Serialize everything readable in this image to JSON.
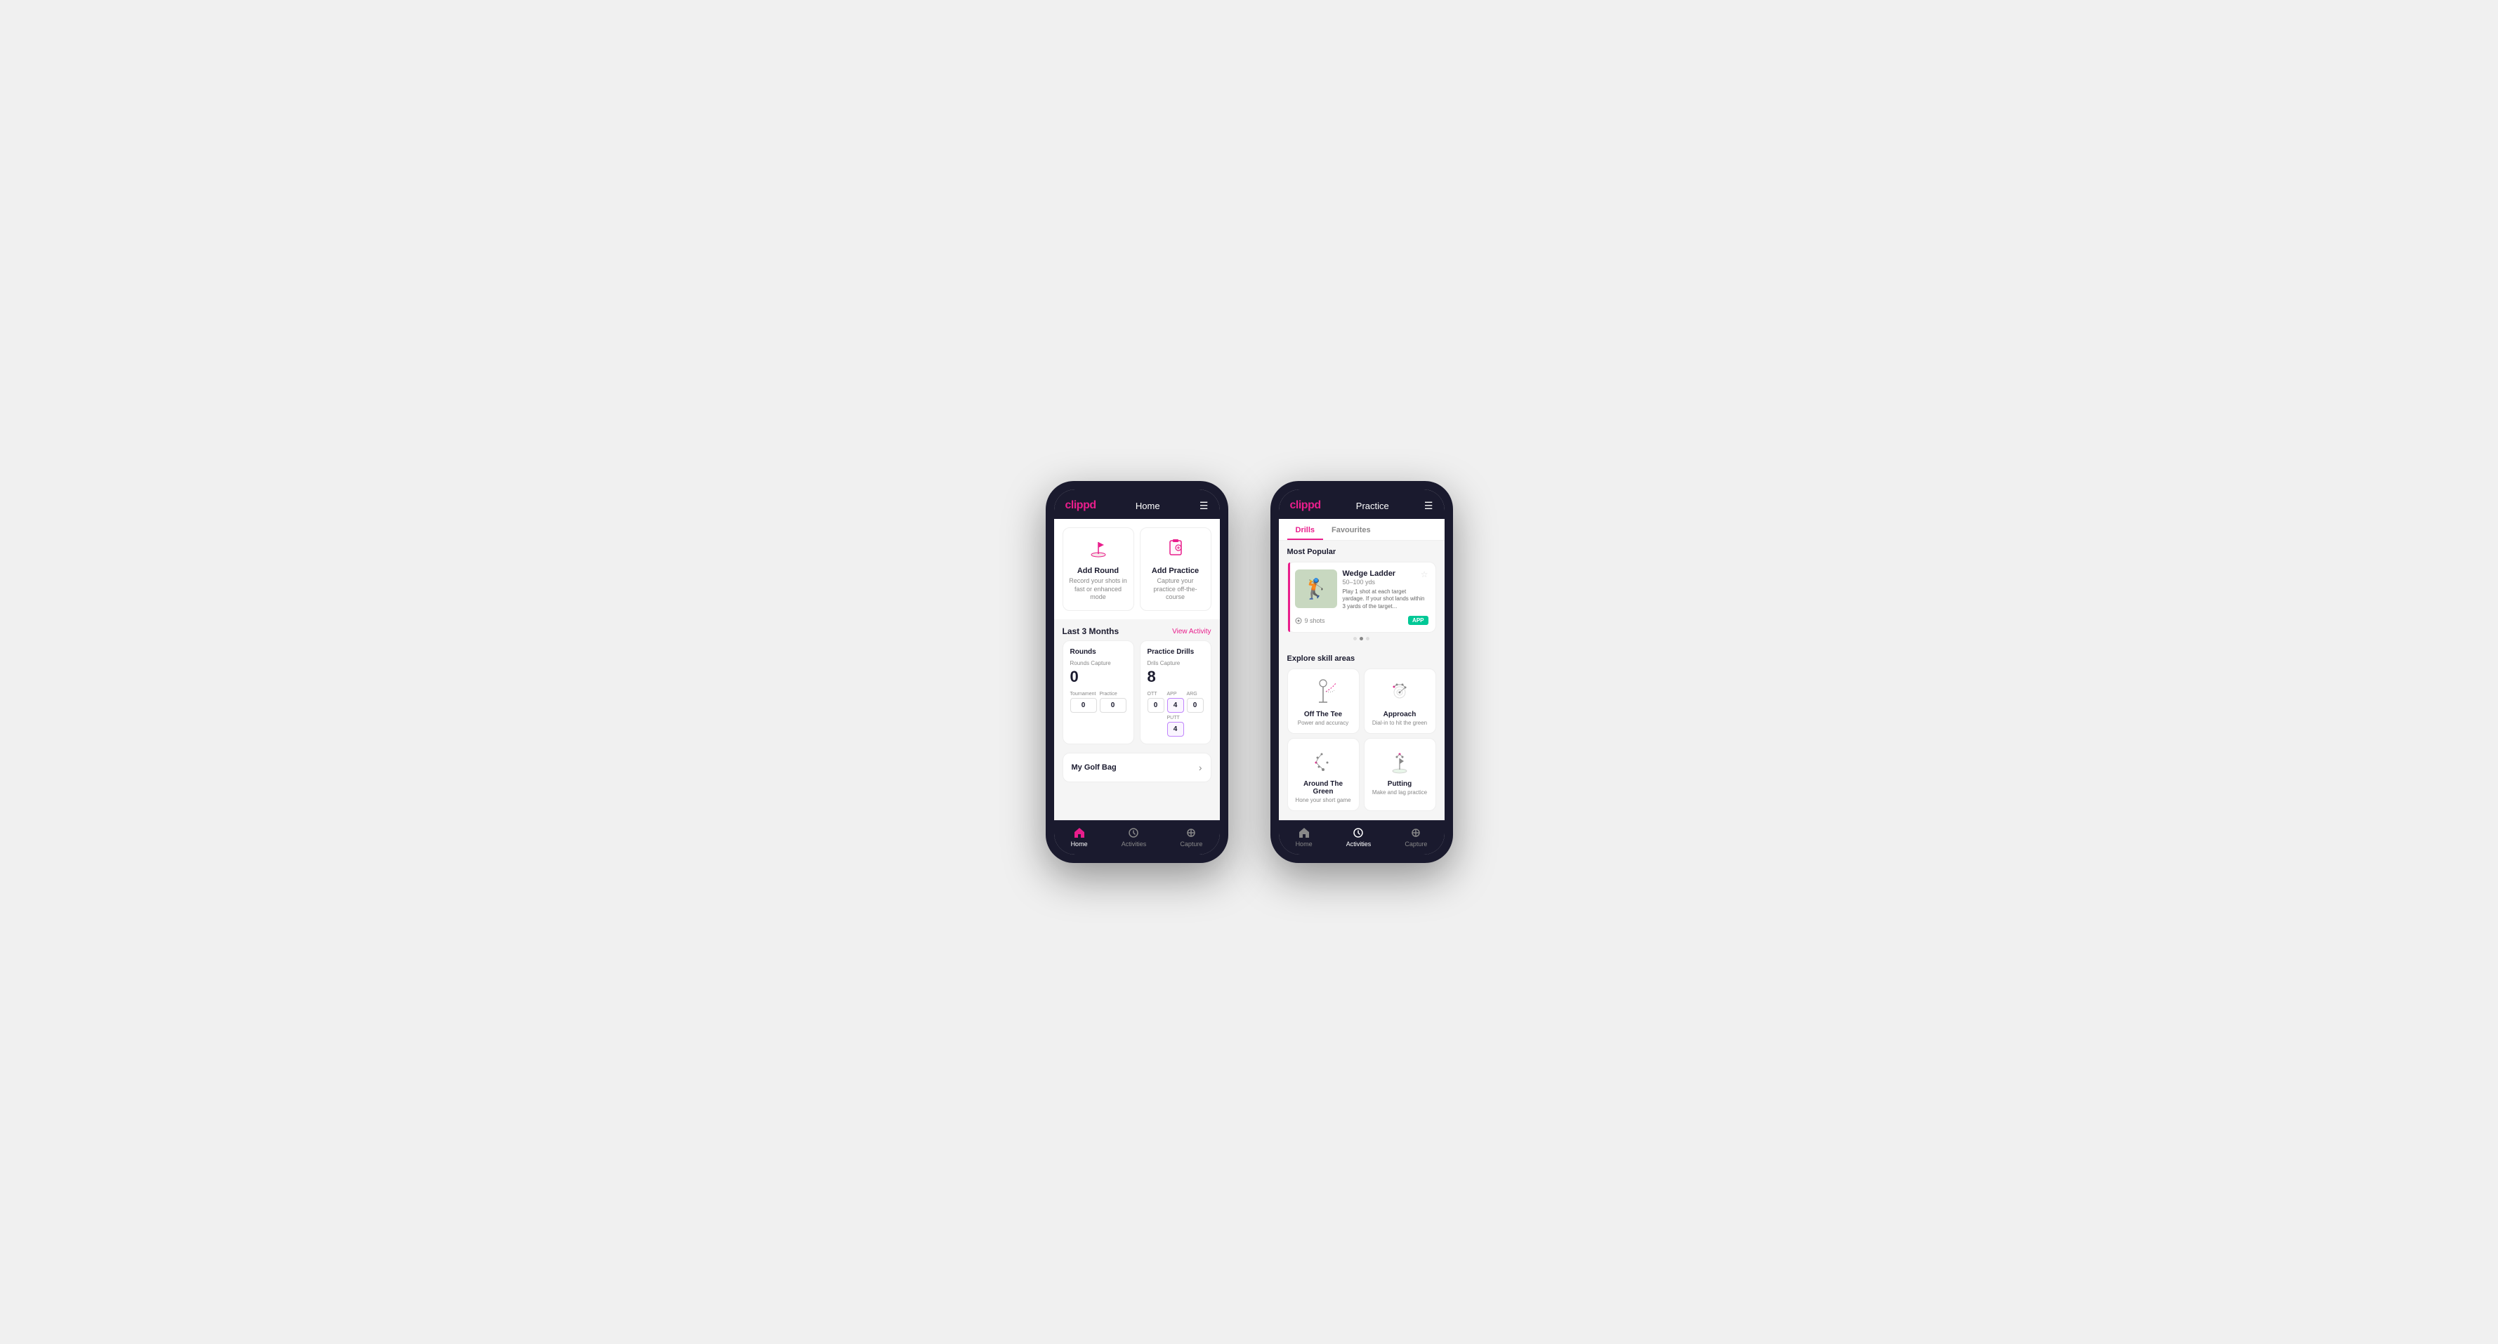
{
  "phone1": {
    "header": {
      "logo": "clippd",
      "title": "Home",
      "menu_icon": "☰"
    },
    "actions": [
      {
        "id": "add-round",
        "title": "Add Round",
        "desc": "Record your shots in fast or enhanced mode",
        "icon": "golf-flag"
      },
      {
        "id": "add-practice",
        "title": "Add Practice",
        "desc": "Capture your practice off-the-course",
        "icon": "clipboard"
      }
    ],
    "activity_section": {
      "title": "Last 3 Months",
      "link": "View Activity"
    },
    "rounds": {
      "title": "Rounds",
      "capture_label": "Rounds Capture",
      "total": "0",
      "sub_stats": [
        {
          "label": "Tournament",
          "value": "0"
        },
        {
          "label": "Practice",
          "value": "0"
        }
      ]
    },
    "practice_drills": {
      "title": "Practice Drills",
      "capture_label": "Drils Capture",
      "total": "8",
      "sub_stats": [
        {
          "label": "OTT",
          "value": "0"
        },
        {
          "label": "APP",
          "value": "4",
          "highlighted": true
        },
        {
          "label": "ARG",
          "value": "0"
        },
        {
          "label": "PUTT",
          "value": "4",
          "highlighted": true
        }
      ]
    },
    "golf_bag": {
      "label": "My Golf Bag"
    },
    "nav": [
      {
        "label": "Home",
        "active": true,
        "icon": "home"
      },
      {
        "label": "Activities",
        "active": false,
        "icon": "activities"
      },
      {
        "label": "Capture",
        "active": false,
        "icon": "capture"
      }
    ]
  },
  "phone2": {
    "header": {
      "logo": "clippd",
      "title": "Practice",
      "menu_icon": "☰"
    },
    "tabs": [
      {
        "label": "Drills",
        "active": true
      },
      {
        "label": "Favourites",
        "active": false
      }
    ],
    "most_popular": {
      "label": "Most Popular",
      "drill": {
        "name": "Wedge Ladder",
        "range": "50–100 yds",
        "desc": "Play 1 shot at each target yardage. If your shot lands within 3 yards of the target...",
        "shots": "9 shots",
        "badge": "APP"
      }
    },
    "dots": [
      {
        "active": false
      },
      {
        "active": true
      },
      {
        "active": false
      }
    ],
    "explore": {
      "title": "Explore skill areas",
      "skills": [
        {
          "name": "Off The Tee",
          "desc": "Power and accuracy",
          "icon": "tee"
        },
        {
          "name": "Approach",
          "desc": "Dial-in to hit the green",
          "icon": "approach"
        },
        {
          "name": "Around The Green",
          "desc": "Hone your short game",
          "icon": "around-green"
        },
        {
          "name": "Putting",
          "desc": "Make and lag practice",
          "icon": "putting"
        }
      ]
    },
    "nav": [
      {
        "label": "Home",
        "active": false,
        "icon": "home"
      },
      {
        "label": "Activities",
        "active": true,
        "icon": "activities"
      },
      {
        "label": "Capture",
        "active": false,
        "icon": "capture"
      }
    ]
  }
}
